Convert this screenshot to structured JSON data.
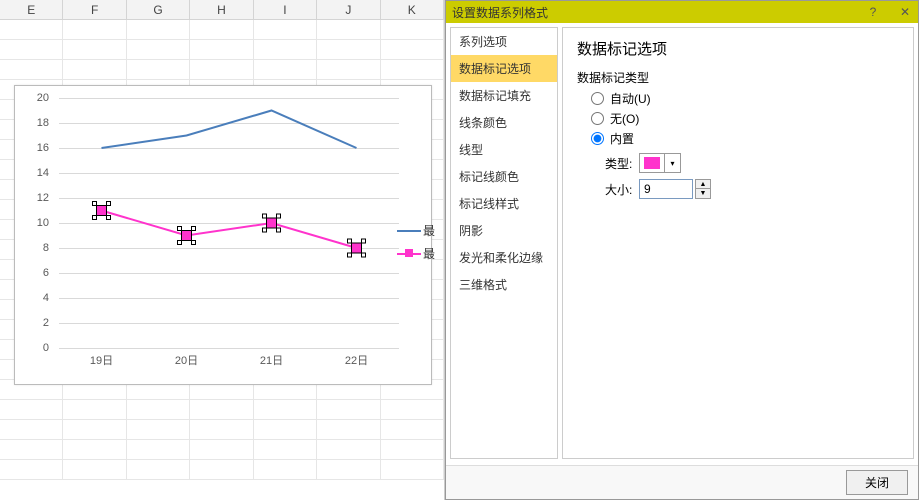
{
  "columns": [
    "E",
    "F",
    "G",
    "H",
    "I",
    "J",
    "K"
  ],
  "chart_data": {
    "type": "line",
    "categories": [
      "19日",
      "20日",
      "21日",
      "22日"
    ],
    "series": [
      {
        "name": "最",
        "values": [
          16,
          17,
          19,
          16
        ],
        "color": "#4a7ebb",
        "marker": "none"
      },
      {
        "name": "最",
        "values": [
          11,
          9,
          10,
          8
        ],
        "color": "#ff33cc",
        "marker": "square"
      }
    ],
    "ylim": [
      0,
      20
    ],
    "ystep": 2,
    "yticks": [
      0,
      2,
      4,
      6,
      8,
      10,
      12,
      14,
      16,
      18,
      20
    ]
  },
  "dialog": {
    "title": "设置数据系列格式",
    "help_btn": "?",
    "close_x": "✕",
    "nav": [
      "系列选项",
      "数据标记选项",
      "数据标记填充",
      "线条颜色",
      "线型",
      "标记线颜色",
      "标记线样式",
      "阴影",
      "发光和柔化边缘",
      "三维格式"
    ],
    "nav_active": 1,
    "panel_title": "数据标记选项",
    "group_label": "数据标记类型",
    "radio_auto": "自动(U)",
    "radio_none": "无(O)",
    "radio_builtin": "内置",
    "radio_selected": "builtin",
    "type_label": "类型:",
    "size_label": "大小:",
    "size_value": "9",
    "close_btn": "关闭"
  }
}
